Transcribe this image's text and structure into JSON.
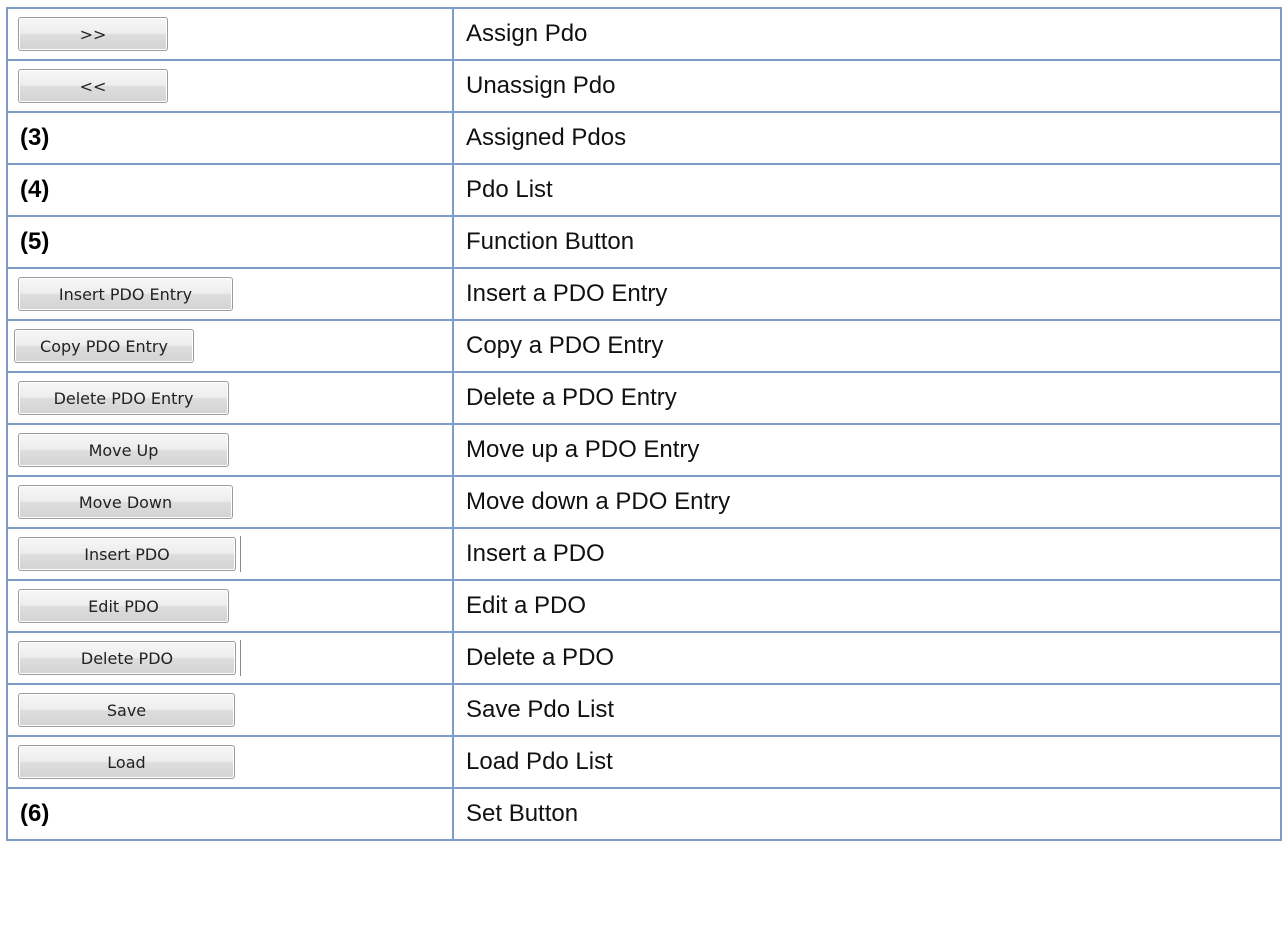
{
  "rows": [
    {
      "left_type": "button",
      "left": ">>",
      "right": "Assign Pdo"
    },
    {
      "left_type": "button",
      "left": "<<",
      "right": "Unassign Pdo"
    },
    {
      "left_type": "label",
      "left": "(3)",
      "right": "Assigned Pdos"
    },
    {
      "left_type": "label",
      "left": "(4)",
      "right": "Pdo List"
    },
    {
      "left_type": "label",
      "left": "(5)",
      "right": "Function Button"
    },
    {
      "left_type": "button",
      "left": "Insert PDO Entry",
      "right": "Insert a PDO Entry"
    },
    {
      "left_type": "button",
      "left": "Copy PDO Entry",
      "right": "Copy a PDO Entry"
    },
    {
      "left_type": "button",
      "left": "Delete PDO Entry",
      "right": "Delete a PDO Entry"
    },
    {
      "left_type": "button",
      "left": "Move Up",
      "right": "Move up a PDO Entry"
    },
    {
      "left_type": "button",
      "left": "Move Down",
      "right": "Move down a PDO Entry"
    },
    {
      "left_type": "button",
      "left": "Insert PDO",
      "right": "Insert a PDO"
    },
    {
      "left_type": "button",
      "left": "Edit PDO",
      "right": "Edit a PDO"
    },
    {
      "left_type": "button",
      "left": "Delete PDO",
      "right": "Delete a PDO"
    },
    {
      "left_type": "button",
      "left": "Save",
      "right": "Save Pdo List"
    },
    {
      "left_type": "button",
      "left": "Load",
      "right": "Load Pdo List"
    },
    {
      "left_type": "label",
      "left": "(6)",
      "right": "Set Button"
    }
  ],
  "colors": {
    "border": "#7f9cc9",
    "button_face": "#e6e6e6",
    "text": "#111111"
  }
}
